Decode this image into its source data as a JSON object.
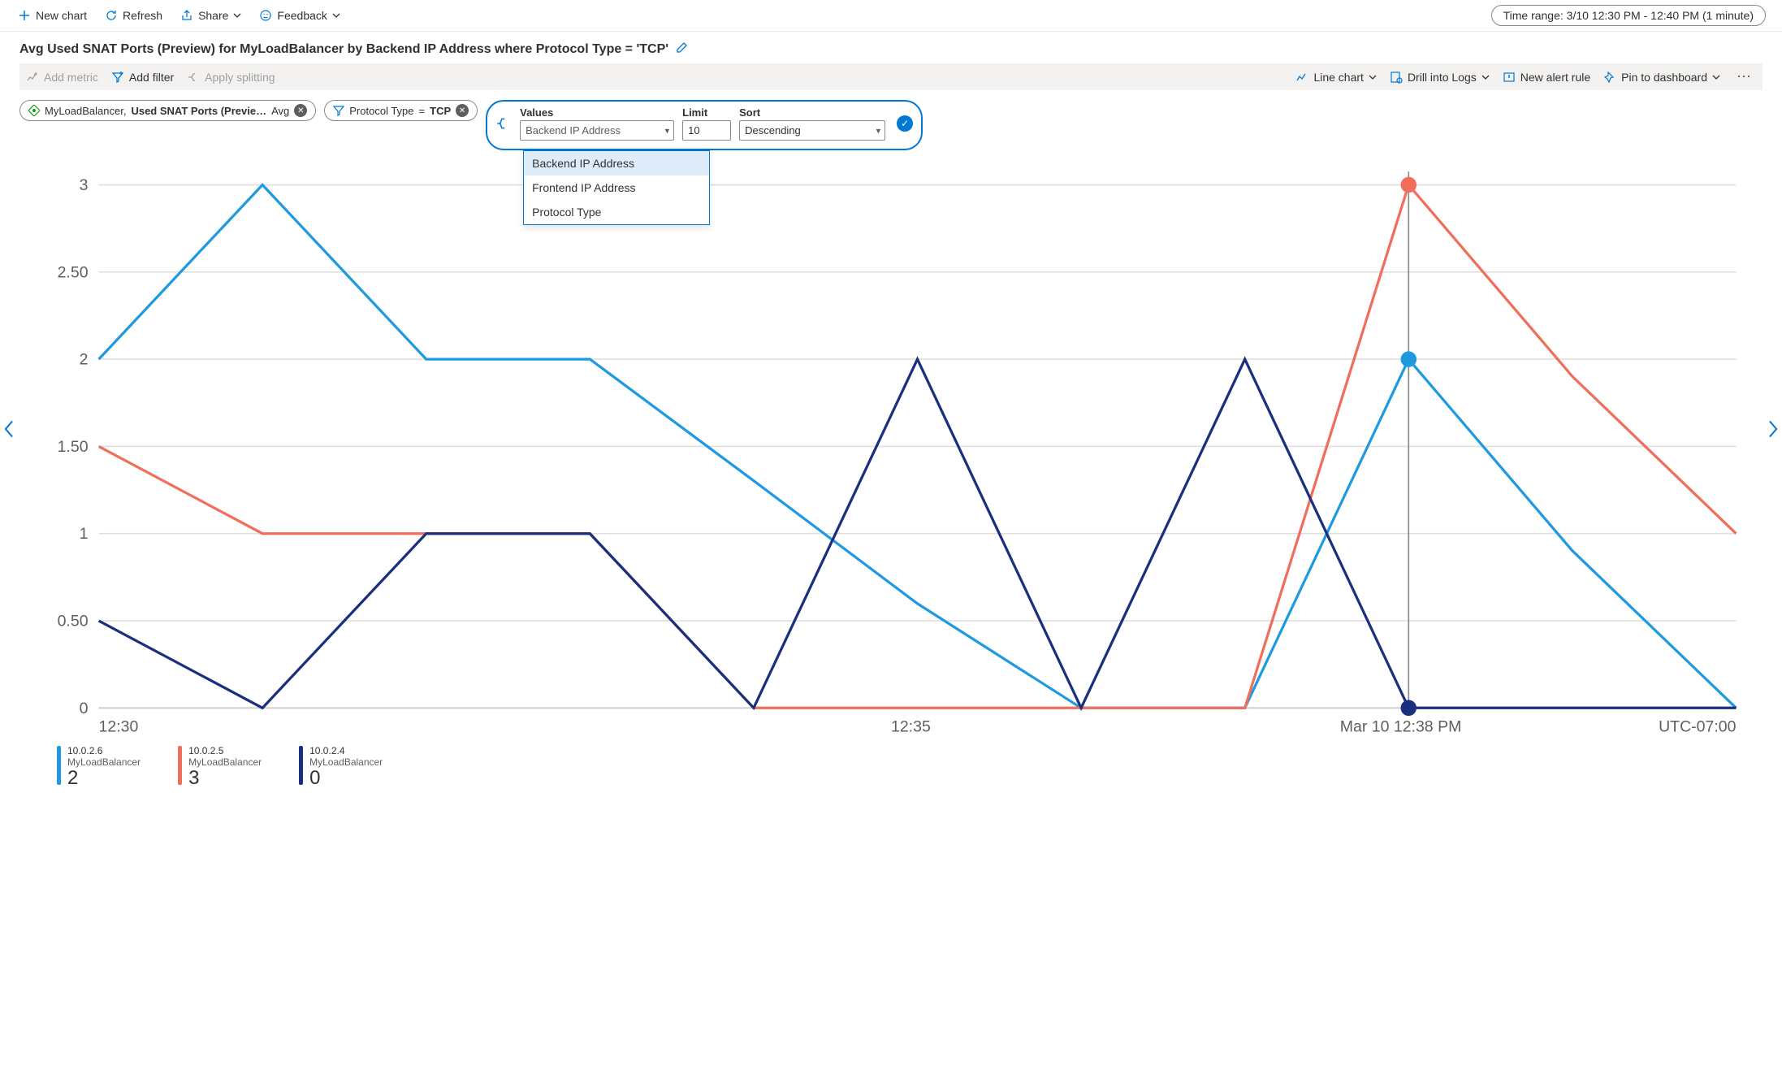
{
  "toolbar": {
    "new_chart": "New chart",
    "refresh": "Refresh",
    "share": "Share",
    "feedback": "Feedback",
    "time_range": "Time range: 3/10 12:30 PM - 12:40 PM (1 minute)"
  },
  "chart_title": "Avg Used SNAT Ports (Preview) for MyLoadBalancer by Backend IP Address where Protocol Type = 'TCP'",
  "metric_bar": {
    "add_metric": "Add metric",
    "add_filter": "Add filter",
    "apply_splitting": "Apply splitting",
    "chart_type": "Line chart",
    "drill_logs": "Drill into Logs",
    "new_alert": "New alert rule",
    "pin_dashboard": "Pin to dashboard"
  },
  "pills": {
    "metric_resource": "MyLoadBalancer,",
    "metric_name": "Used SNAT Ports (Previe…",
    "metric_agg": "Avg",
    "filter_text_a": "Protocol Type",
    "filter_eq": "=",
    "filter_text_b": "TCP"
  },
  "split": {
    "values_label": "Values",
    "values_value": "Backend IP Address",
    "limit_label": "Limit",
    "limit_value": "10",
    "sort_label": "Sort",
    "sort_value": "Descending",
    "options": [
      "Backend IP Address",
      "Frontend IP Address",
      "Protocol Type"
    ]
  },
  "axis": {
    "y_ticks": [
      "3",
      "2.50",
      "2",
      "1.50",
      "1",
      "0.50",
      "0"
    ],
    "x_ticks": [
      "12:30",
      "12:35"
    ],
    "hover_time": "Mar 10 12:38 PM",
    "tz": "UTC-07:00"
  },
  "legend": [
    {
      "ip": "10.0.2.6",
      "res": "MyLoadBalancer",
      "val": "2",
      "color": "#1f9ae0"
    },
    {
      "ip": "10.0.2.5",
      "res": "MyLoadBalancer",
      "val": "3",
      "color": "#ef6e5c"
    },
    {
      "ip": "10.0.2.4",
      "res": "MyLoadBalancer",
      "val": "0",
      "color": "#1a2f7d"
    }
  ],
  "chart_data": {
    "type": "line",
    "title": "Avg Used SNAT Ports (Preview) for MyLoadBalancer by Backend IP Address where Protocol Type = 'TCP'",
    "xlabel": "",
    "ylabel": "",
    "ylim": [
      0,
      3
    ],
    "x": [
      "12:30",
      "12:31",
      "12:32",
      "12:33",
      "12:34",
      "12:35",
      "12:36",
      "12:37",
      "12:38",
      "12:39",
      "12:40"
    ],
    "series": [
      {
        "name": "10.0.2.6",
        "color": "#1f9ae0",
        "values": [
          2,
          3,
          2,
          2,
          1.3,
          0.6,
          0,
          0,
          2,
          0.9,
          0
        ]
      },
      {
        "name": "10.0.2.5",
        "color": "#ef6e5c",
        "values": [
          1.5,
          1,
          1,
          1,
          0,
          0,
          0,
          0,
          3,
          1.9,
          1
        ]
      },
      {
        "name": "10.0.2.4",
        "color": "#1a2f7d",
        "values": [
          0.5,
          0,
          1,
          1,
          0,
          2,
          0,
          2,
          0,
          0,
          0
        ]
      }
    ],
    "hover_x": "12:38",
    "hover_points": [
      {
        "series": "10.0.2.6",
        "value": 2
      },
      {
        "series": "10.0.2.5",
        "value": 3
      },
      {
        "series": "10.0.2.4",
        "value": 0
      }
    ]
  }
}
